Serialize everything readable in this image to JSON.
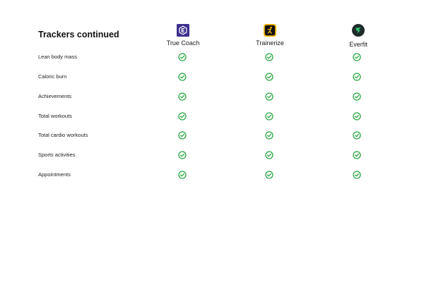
{
  "page": {
    "title": "Trackers continued"
  },
  "apps": [
    {
      "name": "True Coach",
      "logo_icon": "truecoach-logo-icon",
      "logo_color": "#3d2f8f"
    },
    {
      "name": "Trainerize",
      "logo_icon": "trainerize-logo-icon",
      "logo_color": "#f5b800"
    },
    {
      "name": "Everfit",
      "logo_icon": "everfit-logo-icon",
      "logo_color": "#1f2a2a"
    }
  ],
  "features": [
    {
      "label": "Lean body mass",
      "truecoach": true,
      "trainerize": true,
      "everfit": true
    },
    {
      "label": "Caloric burn",
      "truecoach": true,
      "trainerize": true,
      "everfit": true
    },
    {
      "label": "Achievements",
      "truecoach": true,
      "trainerize": true,
      "everfit": true
    },
    {
      "label": "Total workouts",
      "truecoach": true,
      "trainerize": true,
      "everfit": true
    },
    {
      "label": "Total cardio workouts",
      "truecoach": true,
      "trainerize": true,
      "everfit": true
    },
    {
      "label": "Sports activities",
      "truecoach": true,
      "trainerize": true,
      "everfit": true
    },
    {
      "label": "Appointments",
      "truecoach": true,
      "trainerize": true,
      "everfit": true
    }
  ],
  "colors": {
    "check": "#2aa744",
    "title": "#111111",
    "text": "#222222"
  },
  "icons": {
    "check": "check-circle-icon"
  }
}
